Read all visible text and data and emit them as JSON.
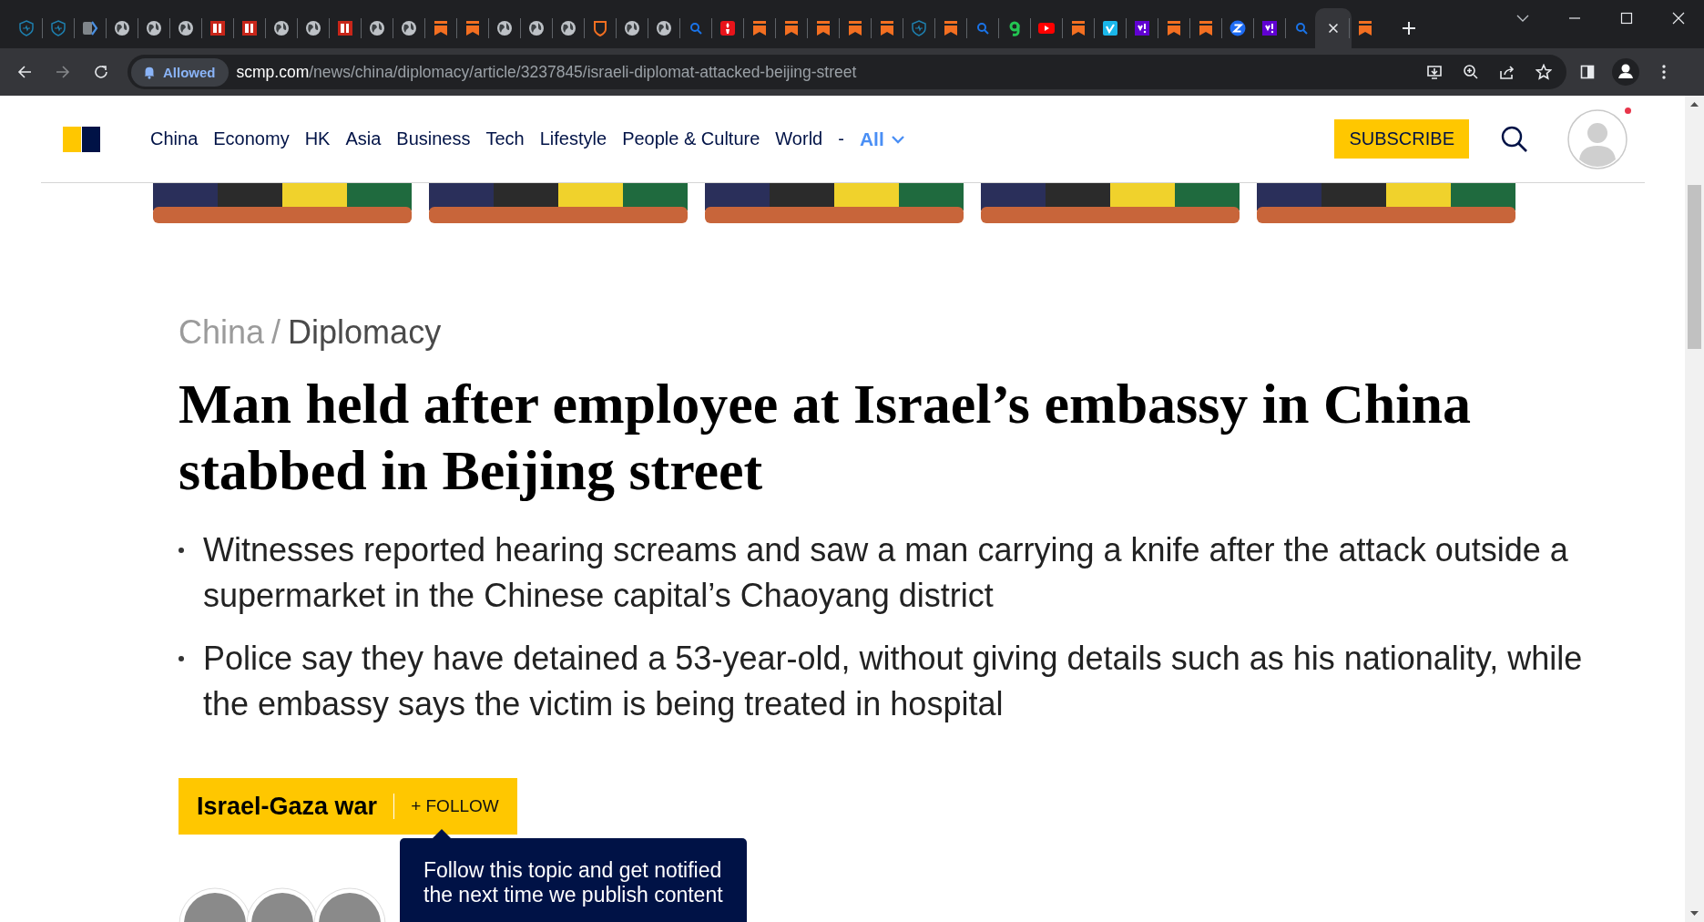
{
  "tabs": [
    {
      "kind": "heart-shield",
      "selected": false
    },
    {
      "kind": "heart-shield",
      "selected": false
    },
    {
      "kind": "tag",
      "selected": false
    },
    {
      "kind": "globe",
      "selected": false
    },
    {
      "kind": "globe",
      "selected": false
    },
    {
      "kind": "globe",
      "selected": false
    },
    {
      "kind": "bi",
      "selected": false
    },
    {
      "kind": "bi",
      "selected": false
    },
    {
      "kind": "globe",
      "selected": false
    },
    {
      "kind": "globe",
      "selected": false
    },
    {
      "kind": "bi",
      "selected": false
    },
    {
      "kind": "globe",
      "selected": false
    },
    {
      "kind": "globe",
      "selected": false
    },
    {
      "kind": "bookmark",
      "selected": false
    },
    {
      "kind": "bookmark",
      "selected": false
    },
    {
      "kind": "globe",
      "selected": false
    },
    {
      "kind": "globe",
      "selected": false
    },
    {
      "kind": "globe",
      "selected": false
    },
    {
      "kind": "shield",
      "selected": false
    },
    {
      "kind": "globe",
      "selected": false
    },
    {
      "kind": "globe",
      "selected": false
    },
    {
      "kind": "search",
      "selected": false
    },
    {
      "kind": "flame",
      "selected": false
    },
    {
      "kind": "bookmark",
      "selected": false
    },
    {
      "kind": "bookmark",
      "selected": false
    },
    {
      "kind": "bookmark",
      "selected": false
    },
    {
      "kind": "bookmark",
      "selected": false
    },
    {
      "kind": "bookmark",
      "selected": false
    },
    {
      "kind": "heart-shield",
      "selected": false
    },
    {
      "kind": "bookmark",
      "selected": false
    },
    {
      "kind": "search",
      "selected": false
    },
    {
      "kind": "hook",
      "selected": false
    },
    {
      "kind": "play",
      "selected": false
    },
    {
      "kind": "bookmark",
      "selected": false
    },
    {
      "kind": "check",
      "selected": false
    },
    {
      "kind": "exclaim",
      "selected": false
    },
    {
      "kind": "bookmark",
      "selected": false
    },
    {
      "kind": "bookmark",
      "selected": false
    },
    {
      "kind": "zigzag",
      "selected": false
    },
    {
      "kind": "exclaim",
      "selected": false
    },
    {
      "kind": "search",
      "selected": false
    },
    {
      "selected": true
    },
    {
      "kind": "bookmark",
      "selected": false
    }
  ],
  "toolbar": {
    "forward_disabled": true,
    "permission_chip": "Allowed",
    "url_host": "scmp.com",
    "url_path": "/news/china/diplomacy/article/3237845/israeli-diplomat-attacked-beijing-street"
  },
  "header": {
    "nav": [
      "China",
      "Economy",
      "HK",
      "Asia",
      "Business",
      "Tech",
      "Lifestyle",
      "People & Culture",
      "World"
    ],
    "separator": "-",
    "more": "All",
    "subscribe": "SUBSCRIBE",
    "notification": true
  },
  "article": {
    "breadcrumb": {
      "section": "China",
      "separator": "/",
      "subsection": "Diplomacy"
    },
    "headline": "Man held after employee at Israel’s embassy in China stabbed in Beijing street",
    "bullets": [
      "Witnesses reported hearing screams and saw a man carrying a knife after the attack outside a supermarket in the Chinese capital’s Chaoyang district",
      "Police say they have detained a 53-year-old, without giving details such as his nationality, while the embassy says the victim is being treated in hospital"
    ],
    "topic": {
      "name": "Israel-Gaza war",
      "follow": "+ FOLLOW"
    },
    "tooltip": [
      "Follow this topic and get notified",
      "the next time we publish content"
    ],
    "authors": [
      {
        "kind": "avatar"
      },
      {
        "kind": "avatar"
      },
      {
        "kind": "avatar"
      }
    ]
  }
}
